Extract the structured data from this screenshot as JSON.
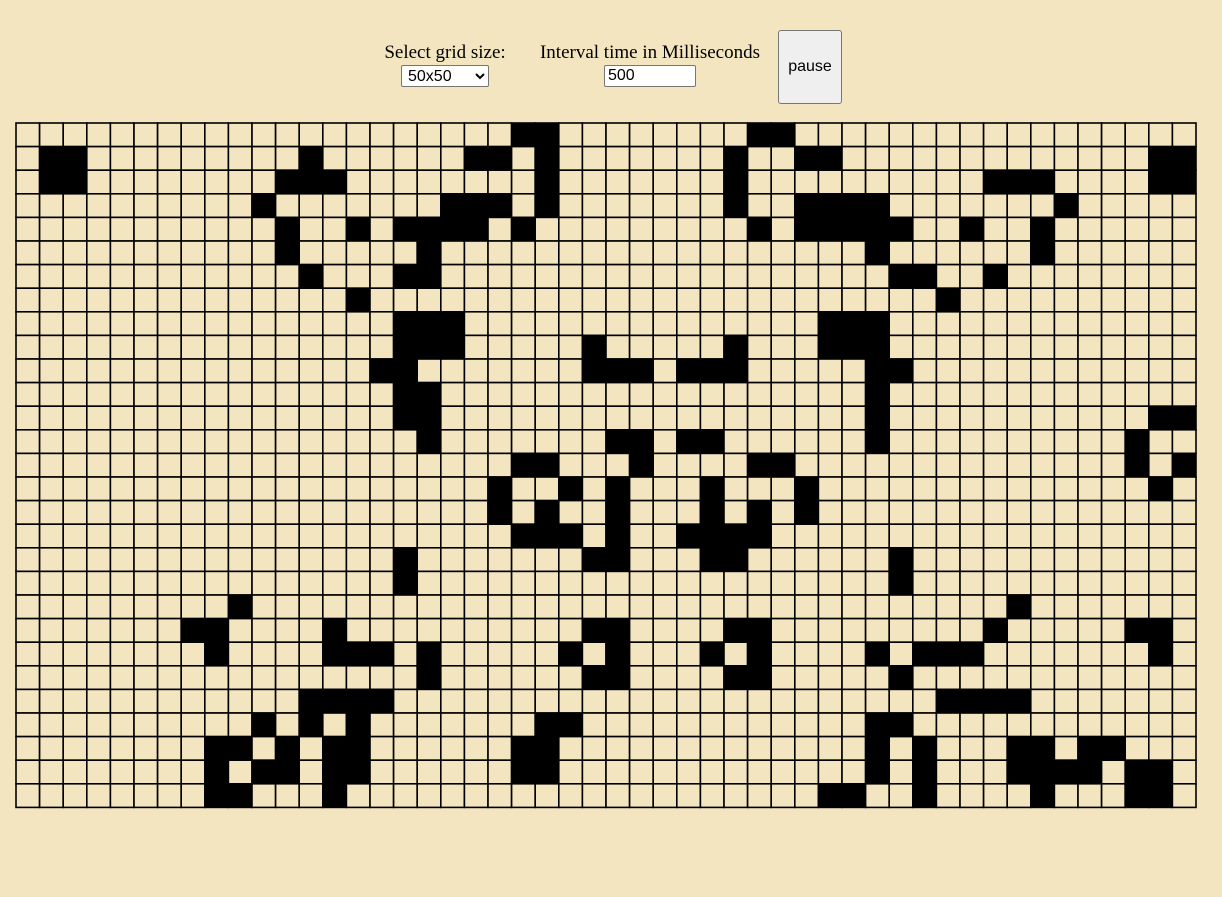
{
  "controls": {
    "grid_size_label": "Select grid size:",
    "grid_size_selected": "50x50",
    "interval_label": "Interval time in Milliseconds",
    "interval_value": "500",
    "pause_label": "pause"
  },
  "grid": {
    "columns": 50,
    "visible_rows": 29,
    "live_color": "#000000",
    "dead_color": "#f3e5c0",
    "line_color": "#000000",
    "rows": [
      "000000000000000000000110000000011000000000000000000",
      "011000000000100000011010000000100110000000000000110",
      "011000000001110000000010000000100000000001110000110",
      "000000000010000000111010000000100111100000001000000",
      "000000000001001011110100000000010111110010010000000",
      "000000000001000001000000000000000000100000010000000",
      "000000000000100011000000000000000000011001000000000",
      "000000000000001000000000000000000000000100000000000",
      "000000000000000011100000000000000011100000000000000",
      "000000000000000011100000100000100011100000000000000",
      "000000000000000110000000111011100000110000000000000",
      "000000000000000011000000000000000000100000000000000",
      "000000000000000011000000000000000000100000000000110",
      "000000000000000001000000011011000000100000000001001",
      "000000000000000000000110001000011000000000000001010",
      "000000000000000000001001010001000100000000000000100",
      "000000000000000000001010010001010100000000000000000",
      "000000000000000000000111010011110000000000000000000",
      "000000000000000010000000110001100000010000000000000",
      "000000000000000010000000000000000000010000000000000",
      "000000000100000000000000000000000000000000100000000",
      "000000011000010000000000110000110000000001000001100",
      "000000001000011101000001010001010000101110000000100",
      "000000000000000001000000110000110000010000000000000",
      "000000000000111100000000000000000000000111100000000",
      "000000000010101000000011000000000000110000000000000",
      "000000001101011000000110000000000000101000110110000",
      "000000001011011000000110000000000000101000111101100",
      "000000001100010000000000000000000011001000010001100"
    ]
  }
}
